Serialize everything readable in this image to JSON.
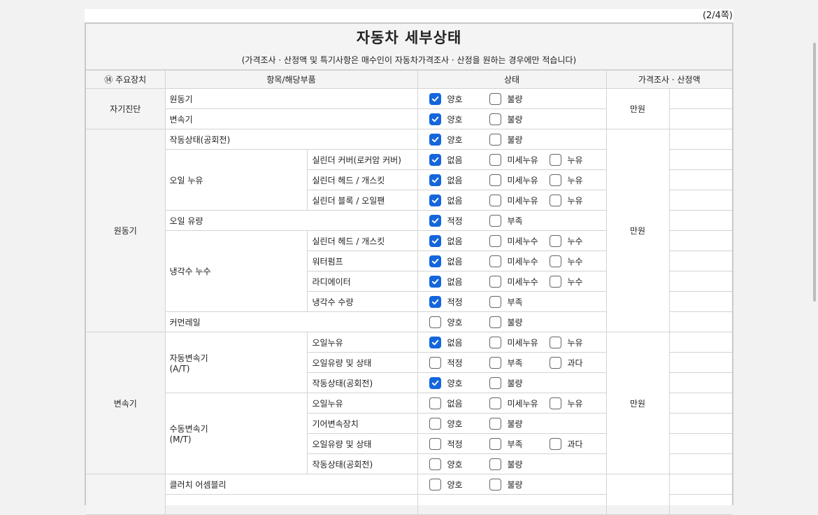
{
  "page_number": "(2/4쪽)",
  "title": "자동차 세부상태",
  "subtitle": "(가격조사 · 산정액 및 특기사항은 매수인이 자동차가격조사 · 산정을 원하는 경우에만 적습니다)",
  "headers": {
    "main_device": "⑭ 주요장치",
    "item": "항목/해당부품",
    "status": "상태",
    "price": "가격조사 · 산정액"
  },
  "unit": "만원",
  "groups": {
    "self_diag": "자기진단",
    "engine": "원동기",
    "transmission": "변속기"
  },
  "items": {
    "engine": "원동기",
    "transmission": "변속기",
    "op_state": "작동상태(공회전)",
    "oil_leak": "오일 누유",
    "oil_level": "오일 유량",
    "coolant_leak": "냉각수 누수",
    "common_rail": "커먼레일",
    "auto_trans_1": "자동변속기",
    "auto_trans_2": "(A/T)",
    "manual_trans_1": "수동변속기",
    "manual_trans_2": "(M/T)",
    "clutch": "클러치 어셈블리"
  },
  "subitems": {
    "cyl_cover": "실린더 커버(로커암 커버)",
    "cyl_head": "실린더 헤드 / 개스킷",
    "cyl_block": "실린더 블록 / 오일팬",
    "water_pump": "워터펌프",
    "radiator": "라디에이터",
    "coolant_qty": "냉각수 수량",
    "oil_leak": "오일누유",
    "oil_level_state": "오일유량 및 상태",
    "op_state": "작동상태(공회전)",
    "gear_shift": "기어변속장치"
  },
  "options": {
    "good": "양호",
    "bad": "불량",
    "none": "없음",
    "minor_oil": "미세누유",
    "oil": "누유",
    "proper": "적정",
    "short": "부족",
    "minor_water": "미세누수",
    "water": "누수",
    "excess": "과다"
  },
  "colors": {
    "check_blue": "#1466dd",
    "header_bg": "#f4f4f4",
    "border": "#d4d4d4"
  },
  "checks": {
    "r1": [
      true,
      false
    ],
    "r2": [
      true,
      false
    ],
    "r3": [
      true,
      false
    ],
    "r4": [
      true,
      false,
      false
    ],
    "r5": [
      true,
      false,
      false
    ],
    "r6": [
      true,
      false,
      false
    ],
    "r7": [
      true,
      false
    ],
    "r8": [
      true,
      false,
      false
    ],
    "r9": [
      true,
      false,
      false
    ],
    "r10": [
      true,
      false,
      false
    ],
    "r11": [
      true,
      false
    ],
    "r12": [
      false,
      false
    ],
    "r13": [
      true,
      false,
      false
    ],
    "r14": [
      false,
      false,
      false
    ],
    "r15": [
      true,
      false
    ],
    "r16": [
      false,
      false,
      false
    ],
    "r17": [
      false,
      false
    ],
    "r18": [
      false,
      false,
      false
    ],
    "r19": [
      false,
      false
    ],
    "r20": [
      false,
      false
    ]
  }
}
